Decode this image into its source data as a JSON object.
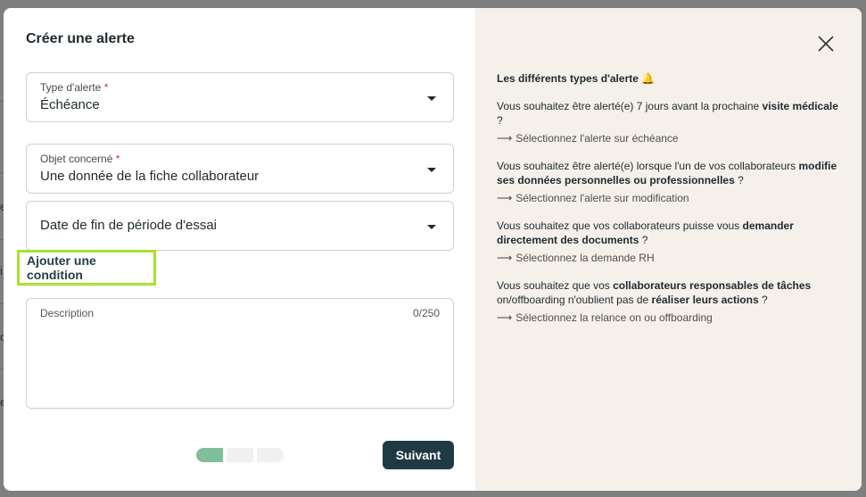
{
  "background": {
    "chars": [
      "e",
      "i",
      "o",
      "e"
    ]
  },
  "modal": {
    "title": "Créer une alerte",
    "type_field": {
      "label": "Type d'alerte",
      "required": "*",
      "value": "Échéance"
    },
    "object_field": {
      "label": "Objet concerné",
      "required": "*",
      "value": "Une donnée de la fiche collaborateur"
    },
    "data_field": {
      "value": "Date de fin de période d'essai"
    },
    "add_condition": "Ajouter une condition",
    "description": {
      "placeholder": "Description",
      "counter": "0/250"
    },
    "stepper": {
      "current": 1,
      "total": 3
    },
    "next_button": "Suivant"
  },
  "help": {
    "title": "Les différents types d'alerte",
    "title_icon": "🔔",
    "items": [
      {
        "q_prefix": "Vous souhaitez être alerté(e) 7 jours avant la prochaine ",
        "q_bold": "visite médicale",
        "q_suffix": " ?",
        "q_bold2": "",
        "q_suffix2": "",
        "answer": "Sélectionnez l'alerte sur échéance"
      },
      {
        "q_prefix": "Vous souhaitez être alerté(e) lorsque l'un de vos collaborateurs ",
        "q_bold": "modifie ses données personnelles ou professionnelles",
        "q_suffix": " ?",
        "q_bold2": "",
        "q_suffix2": "",
        "answer": "Sélectionnez l'alerte sur modification"
      },
      {
        "q_prefix": "Vous souhaitez que vos collaborateurs puisse vous ",
        "q_bold": "demander directement des documents",
        "q_suffix": " ?",
        "q_bold2": "",
        "q_suffix2": "",
        "answer": "Sélectionnez la demande RH"
      },
      {
        "q_prefix": "Vous souhaitez que vos ",
        "q_bold": "collaborateurs responsables de tâches",
        "q_suffix": " on/offboarding n'oublient pas de ",
        "q_bold2": "réaliser leurs actions",
        "q_suffix2": " ?",
        "answer": "Sélectionnez la relance on ou offboarding"
      }
    ],
    "arrow": "⟶"
  },
  "colors": {
    "accent_highlight": "#a6e22e",
    "primary_button": "#1f3a44",
    "step_active": "#7fbf99",
    "panel_bg": "#f5f0ea"
  }
}
